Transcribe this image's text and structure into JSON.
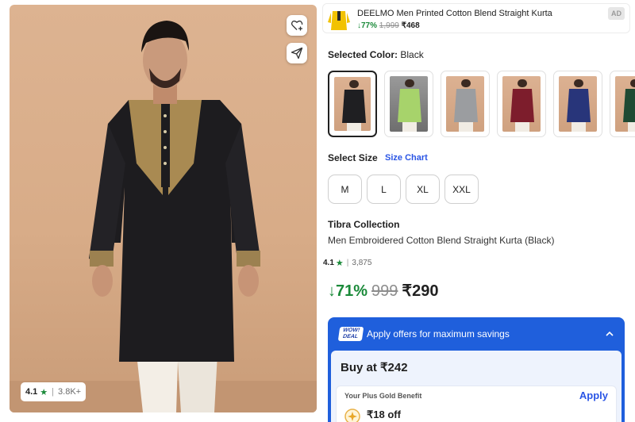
{
  "hero": {
    "rating": "4.1",
    "rating_count": "3.8K+"
  },
  "ad": {
    "title": "DEELMO Men Printed Cotton Blend Straight Kurta",
    "discount": "↓77%",
    "mrp": "1,999",
    "price": "₹468",
    "badge": "AD"
  },
  "color": {
    "label": "Selected Color:",
    "value": "Black",
    "swatches": [
      {
        "name": "black",
        "color": "#1f1f22",
        "selected": true
      },
      {
        "name": "lime",
        "color": "#a7d36b",
        "selected": false
      },
      {
        "name": "grey",
        "color": "#9b9da0",
        "selected": false
      },
      {
        "name": "maroon",
        "color": "#7d1d2c",
        "selected": false
      },
      {
        "name": "navy",
        "color": "#28357a",
        "selected": false
      },
      {
        "name": "green",
        "color": "#1f4a33",
        "selected": false
      }
    ]
  },
  "size": {
    "label": "Select Size",
    "chart_link": "Size Chart",
    "options": [
      "M",
      "L",
      "XL",
      "XXL"
    ]
  },
  "product": {
    "brand": "Tibra Collection",
    "name": "Men Embroidered Cotton Blend Straight Kurta (Black)",
    "rating": "4.1",
    "rating_count": "3,875",
    "discount": "↓71%",
    "mrp": "999",
    "price": "₹290"
  },
  "offers": {
    "wow_line1": "WOW!",
    "wow_line2": "DEAL",
    "title": "Apply offers for maximum savings",
    "buy_at": "Buy at ₹242",
    "benefit_label": "Your Plus Gold Benefit",
    "apply": "Apply",
    "off_text": "₹18 off"
  },
  "colors": {
    "accent_blue": "#2a55e5",
    "offers_blue": "#1f5fdc",
    "green": "#1b8a3a"
  }
}
